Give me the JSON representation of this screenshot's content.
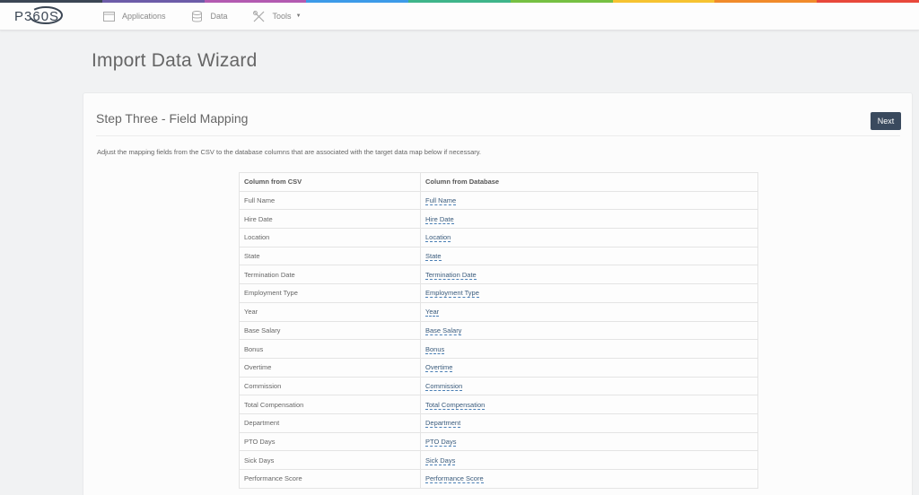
{
  "brand": {
    "logo_text": "P360S",
    "accent_colors": [
      "#3b4654",
      "#6c5ca8",
      "#b35ab1",
      "#3d9be9",
      "#3fb58a",
      "#76c043",
      "#f6c331",
      "#f18b2b",
      "#e8483b"
    ]
  },
  "nav": {
    "items": [
      {
        "label": "Applications",
        "icon": "calendar-icon"
      },
      {
        "label": "Data",
        "icon": "database-icon"
      },
      {
        "label": "Tools",
        "icon": "tools-icon"
      }
    ]
  },
  "page": {
    "title": "Import Data Wizard"
  },
  "wizard": {
    "step_title": "Step Three - Field Mapping",
    "next_label": "Next",
    "description": "Adjust the mapping fields from the CSV to the database columns that are associated with the target data map below if necessary."
  },
  "mapping_table": {
    "headers": [
      "Column from CSV",
      "Column from Database"
    ],
    "rows": [
      {
        "csv": "Full Name",
        "db": "Full Name"
      },
      {
        "csv": "Hire Date",
        "db": "Hire Date"
      },
      {
        "csv": "Location",
        "db": "Location"
      },
      {
        "csv": "State",
        "db": "State"
      },
      {
        "csv": "Termination Date",
        "db": "Termination Date"
      },
      {
        "csv": "Employment Type",
        "db": "Employment Type"
      },
      {
        "csv": "Year",
        "db": "Year"
      },
      {
        "csv": "Base Salary",
        "db": "Base Salary"
      },
      {
        "csv": "Bonus",
        "db": "Bonus"
      },
      {
        "csv": "Overtime",
        "db": "Overtime"
      },
      {
        "csv": "Commission",
        "db": "Commission"
      },
      {
        "csv": "Total Compensation",
        "db": "Total Compensation"
      },
      {
        "csv": "Department",
        "db": "Department"
      },
      {
        "csv": "PTO Days",
        "db": "PTO Days"
      },
      {
        "csv": "Sick Days",
        "db": "Sick Days"
      },
      {
        "csv": "Performance Score",
        "db": "Performance Score"
      }
    ]
  }
}
